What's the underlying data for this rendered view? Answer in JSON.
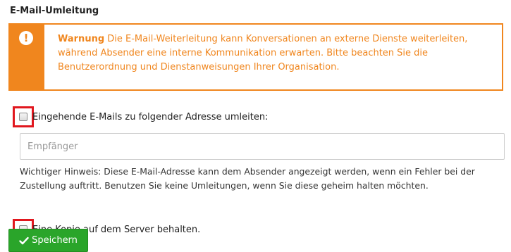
{
  "section": {
    "title": "E-Mail-Umleitung"
  },
  "warning": {
    "label": "Warnung",
    "text": " Die E-Mail-Weiterleitung kann Konversationen an externe Dienste weiterleiten, während Absender eine interne Kommunikation erwarten. Bitte beachten Sie die Benutzerordnung und Dienstanweisungen Ihrer Organisation.",
    "icon": "exclamation-icon",
    "color": "#f0861e"
  },
  "forward": {
    "checkbox_label": "Eingehende E-Mails zu folgender Adresse umleiten:",
    "checked": false
  },
  "recipient": {
    "placeholder": "Empfänger",
    "value": ""
  },
  "hint": {
    "text": "Wichtiger Hinweis: Diese E-Mail-Adresse kann dem Absender angezeigt werden, wenn ein Fehler bei der Zustellung auftritt. Benutzen Sie keine Umleitungen, wenn Sie diese geheim halten möchten."
  },
  "keep_copy": {
    "checkbox_label": "Eine Kopie auf dem Server behalten.",
    "checked": false
  },
  "save": {
    "label": "Speichern",
    "icon": "check-icon",
    "color": "#2aa52a"
  },
  "highlight_color": "#e1171e"
}
